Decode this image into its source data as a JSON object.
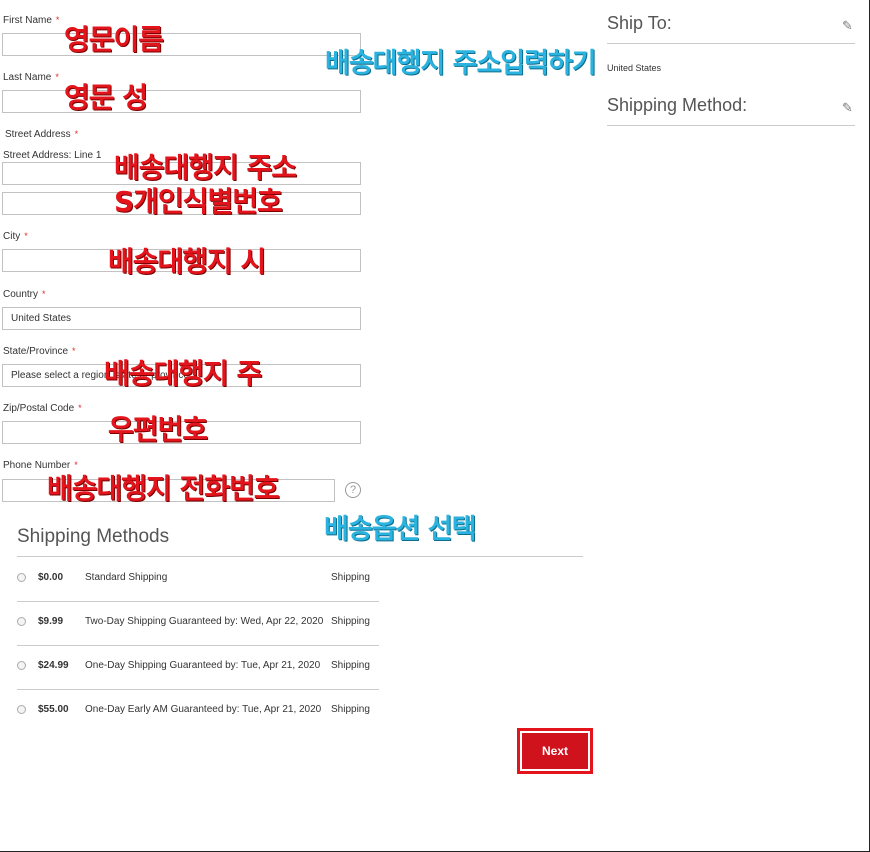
{
  "form": {
    "first_name_label": "First Name",
    "last_name_label": "Last Name",
    "street_address_label": "Street Address",
    "street_line1_label": "Street Address: Line 1",
    "city_label": "City",
    "country_label": "Country",
    "country_value": "United States",
    "state_label": "State/Province",
    "state_placeholder": "Please select a region, state or province.",
    "zip_label": "Zip/Postal Code",
    "phone_label": "Phone Number",
    "required_mark": "*",
    "help_glyph": "?"
  },
  "annotations": {
    "first_name": "영문이름",
    "last_name": "영문 성",
    "address_header": "배송대행지 주소입력하기",
    "street": "배송대행지 주소",
    "street2": "S개인식별번호",
    "city": "배송대행지 시",
    "state": "배송대행지 주",
    "zip": "우편번호",
    "phone": "배송대행지 전화번호",
    "shipping_option": "배송옵션 선택"
  },
  "summary": {
    "ship_to_title": "Ship To:",
    "ship_to_address": "United States",
    "shipping_method_title": "Shipping Method:",
    "edit_icon": "pencil-icon"
  },
  "shipping_methods": {
    "title": "Shipping Methods",
    "options": [
      {
        "price": "$0.00",
        "description": "Standard Shipping",
        "carrier": "Shipping"
      },
      {
        "price": "$9.99",
        "description": "Two-Day Shipping Guaranteed by: Wed, Apr 22, 2020",
        "carrier": "Shipping"
      },
      {
        "price": "$24.99",
        "description": "One-Day Shipping Guaranteed by: Tue, Apr 21, 2020",
        "carrier": "Shipping"
      },
      {
        "price": "$55.00",
        "description": "One-Day Early AM Guaranteed by: Tue, Apr 21, 2020",
        "carrier": "Shipping"
      }
    ]
  },
  "actions": {
    "next_label": "Next"
  },
  "colors": {
    "accent": "#d0121c",
    "annotation_red": "#e3141b",
    "annotation_cyan": "#2ab3df"
  }
}
